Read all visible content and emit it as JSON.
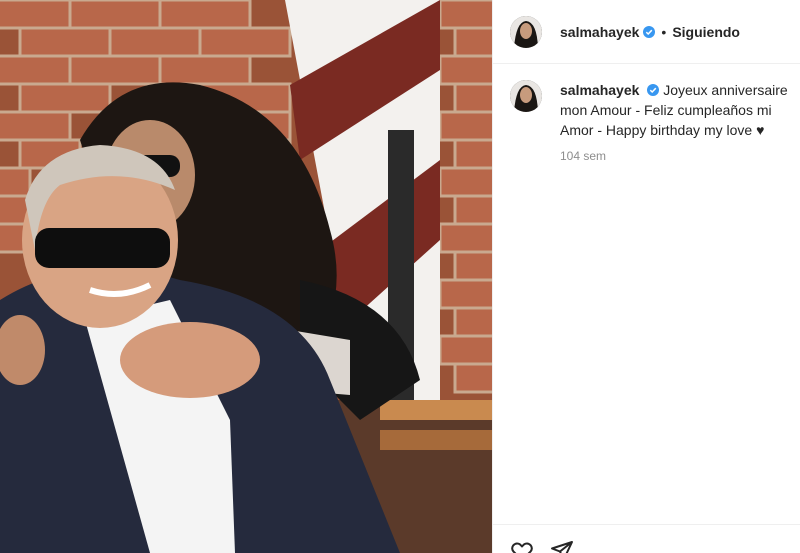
{
  "post": {
    "username": "salmahayek",
    "follow_status": "Siguiendo",
    "separator": "•",
    "caption": "Joyeux anniversaire mon Amour - Feliz cumpleaños mi Amor - Happy birthday my love ♥",
    "time_ago": "104 sem"
  },
  "colors": {
    "verified": "#3897f0",
    "text": "#262626",
    "muted": "#8e8e8e"
  },
  "icons": {
    "like": "heart-icon",
    "share": "paper-plane-icon",
    "verified": "verified-badge-icon"
  }
}
